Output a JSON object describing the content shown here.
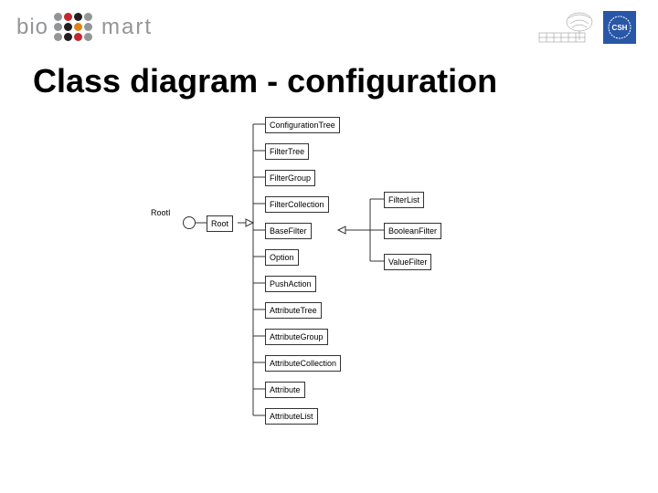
{
  "header": {
    "logo_left_1": "bio",
    "logo_left_2": "mart",
    "logo_right_badge": "CSH"
  },
  "title": "Class diagram - configuration",
  "diagram": {
    "interface_label": "RootI",
    "root": "Root",
    "center_stack": [
      "ConfigurationTree",
      "FilterTree",
      "FilterGroup",
      "FilterCollection",
      "BaseFilter",
      "Option",
      "PushAction",
      "AttributeTree",
      "AttributeGroup",
      "AttributeCollection",
      "Attribute",
      "AttributeList"
    ],
    "right_stack": [
      "FilterList",
      "BooleanFilter",
      "ValueFilter"
    ]
  }
}
